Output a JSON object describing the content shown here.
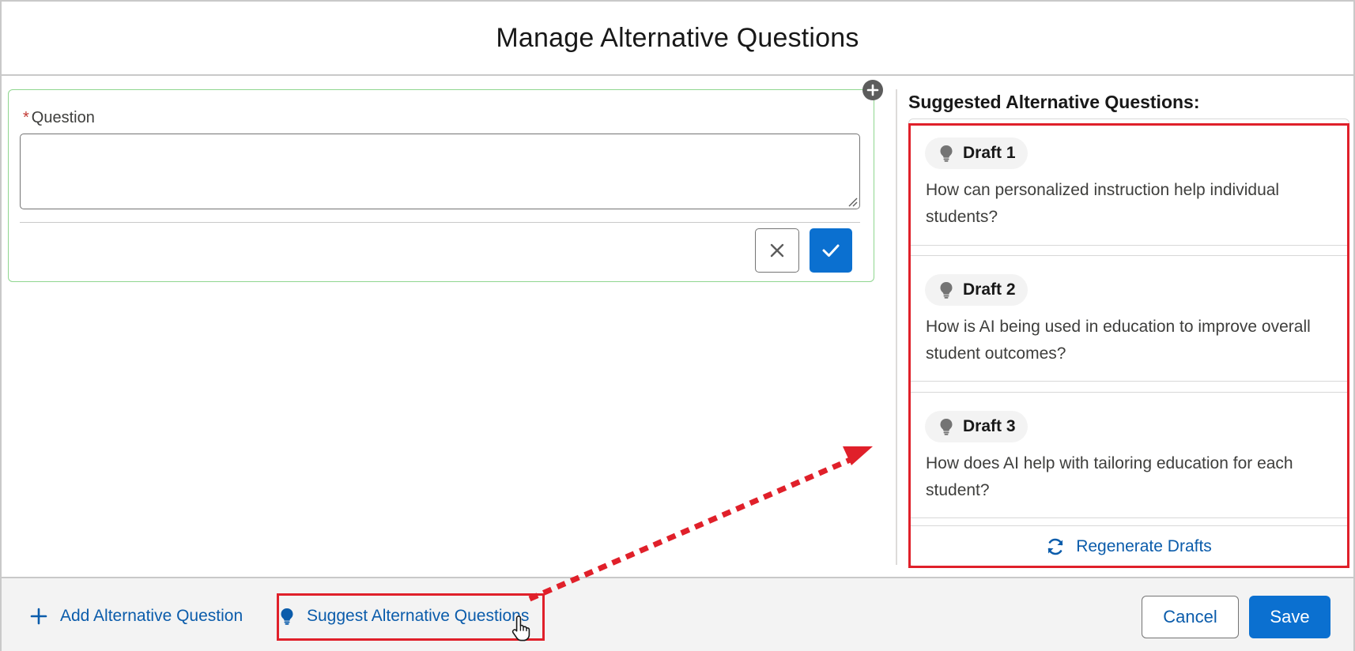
{
  "modal": {
    "title": "Manage Alternative Questions"
  },
  "editor": {
    "field_label": "Question",
    "required_marker": "*",
    "question_value": ""
  },
  "panel": {
    "title": "Suggested Alternative Questions:",
    "drafts": [
      {
        "label": "Draft 1",
        "text": "How can personalized instruction help individual students?"
      },
      {
        "label": "Draft 2",
        "text": "How is AI being used in education to improve overall student outcomes?"
      },
      {
        "label": "Draft 3",
        "text": "How does AI help with tailoring education for each student?"
      }
    ],
    "regenerate_label": "Regenerate Drafts"
  },
  "footer": {
    "add_label": "Add Alternative Question",
    "suggest_label": "Suggest Alternative Questions",
    "cancel_label": "Cancel",
    "save_label": "Save"
  },
  "colors": {
    "brand": "#0b70d0",
    "link": "#0b5cab",
    "highlight": "#e0202a",
    "success_border": "#8fd68f"
  },
  "icons": [
    "add-circle-icon",
    "close-icon",
    "check-icon",
    "lightbulb-icon",
    "refresh-icon",
    "plus-icon",
    "hand-cursor-icon"
  ]
}
